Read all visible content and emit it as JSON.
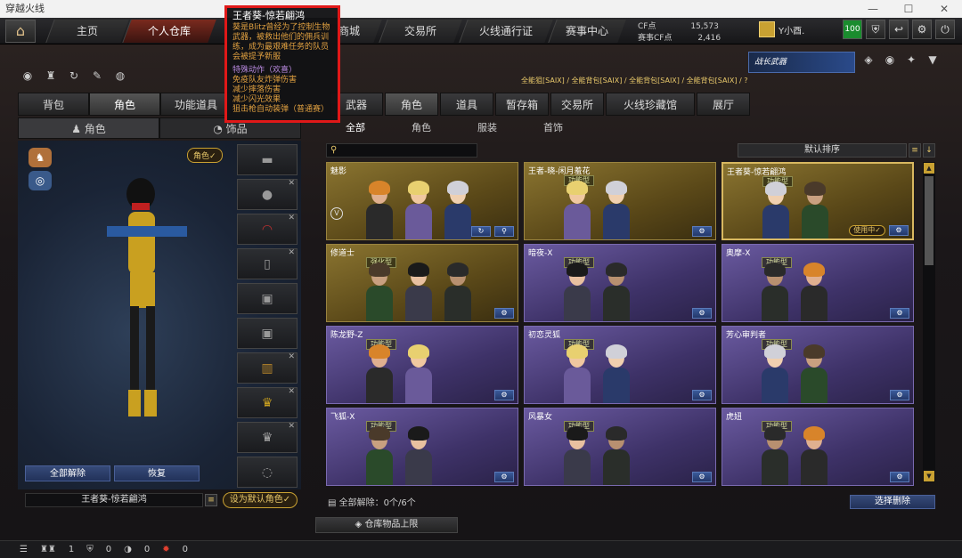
{
  "window": {
    "title": "穿越火线",
    "controls": [
      "—",
      "☐",
      "✕"
    ]
  },
  "nav": {
    "home_icon": "home-icon",
    "tabs": [
      "主页",
      "个人仓库",
      "商城",
      "交易所",
      "火线通行证",
      "赛事中心"
    ]
  },
  "currency": {
    "cf_label": "CF点",
    "cf_value": "15,573",
    "match_label": "赛事CF点",
    "match_value": "2,416"
  },
  "user": {
    "name": "Y小酉."
  },
  "top_icons": {
    "level": "100",
    "items": [
      "shield-icon",
      "exit-icon",
      "gear-icon",
      "power-icon"
    ]
  },
  "tooltip": {
    "title": "王者葵-惊若翩鸿",
    "desc": "葵是Blitz曾经为了控制生物武器，被救出他们的佣兵训练，成为最艰难任务的队员会被提予新服",
    "section": "特殊动作（欢喜）",
    "lines": [
      "免疫队友炸弹伤害",
      "减少摔落伤害",
      "减少闪光效果",
      "狙击枪自动装弹（普通赛）"
    ]
  },
  "left": {
    "tabs": [
      "背包",
      "角色",
      "功能道具"
    ],
    "subtabs": [
      "角色",
      "饰品"
    ],
    "role_badge": "角色✓",
    "unequip_all": "全部解除",
    "restore": "恢复",
    "char_name": "王者葵-惊若翩鸿",
    "set_default": "设为默认角色✓"
  },
  "breadcrumb": "全能狙[SAIX] / 全能背包[SAIX] / 全能背包[SAIX] / 全能背包[SAIX] / ?",
  "banner": "战长武器",
  "right": {
    "tabs": [
      "武器",
      "角色",
      "道具",
      "暂存箱",
      "交易所",
      "火线珍藏馆",
      "展厅"
    ],
    "subtabs": [
      "全部",
      "角色",
      "服装",
      "首饰"
    ],
    "search_placeholder": "",
    "sort": "默认排序",
    "cards": [
      {
        "name": "魅影",
        "tag": "",
        "style": "gold"
      },
      {
        "name": "王者-晓-闲月羞花",
        "tag": "功能型",
        "style": "gold"
      },
      {
        "name": "王者葵-惊若翩鸿",
        "tag": "功能型",
        "style": "gold",
        "in_use": "使用中✓"
      },
      {
        "name": "修道士",
        "tag": "强化型",
        "style": "gold"
      },
      {
        "name": "暗夜-X",
        "tag": "功能型",
        "style": "purple"
      },
      {
        "name": "奥摩-X",
        "tag": "功能型",
        "style": "purple"
      },
      {
        "name": "陈龙野-Z",
        "tag": "功能型",
        "style": "purple"
      },
      {
        "name": "初恋灵狐",
        "tag": "功能型",
        "style": "purple"
      },
      {
        "name": "芳心审判者",
        "tag": "功能型",
        "style": "purple"
      },
      {
        "name": "飞狐-X",
        "tag": "功能型",
        "style": "purple"
      },
      {
        "name": "风暴女",
        "tag": "功能型",
        "style": "purple"
      },
      {
        "name": "虎妞",
        "tag": "功能型",
        "style": "purple"
      }
    ],
    "unequip_count": "全部解除：0个/6个",
    "select_delete": "选择删除",
    "warehouse": "仓库物品上限"
  },
  "statusbar": {
    "a": "1",
    "b": "0",
    "c": "0",
    "d": "0"
  }
}
